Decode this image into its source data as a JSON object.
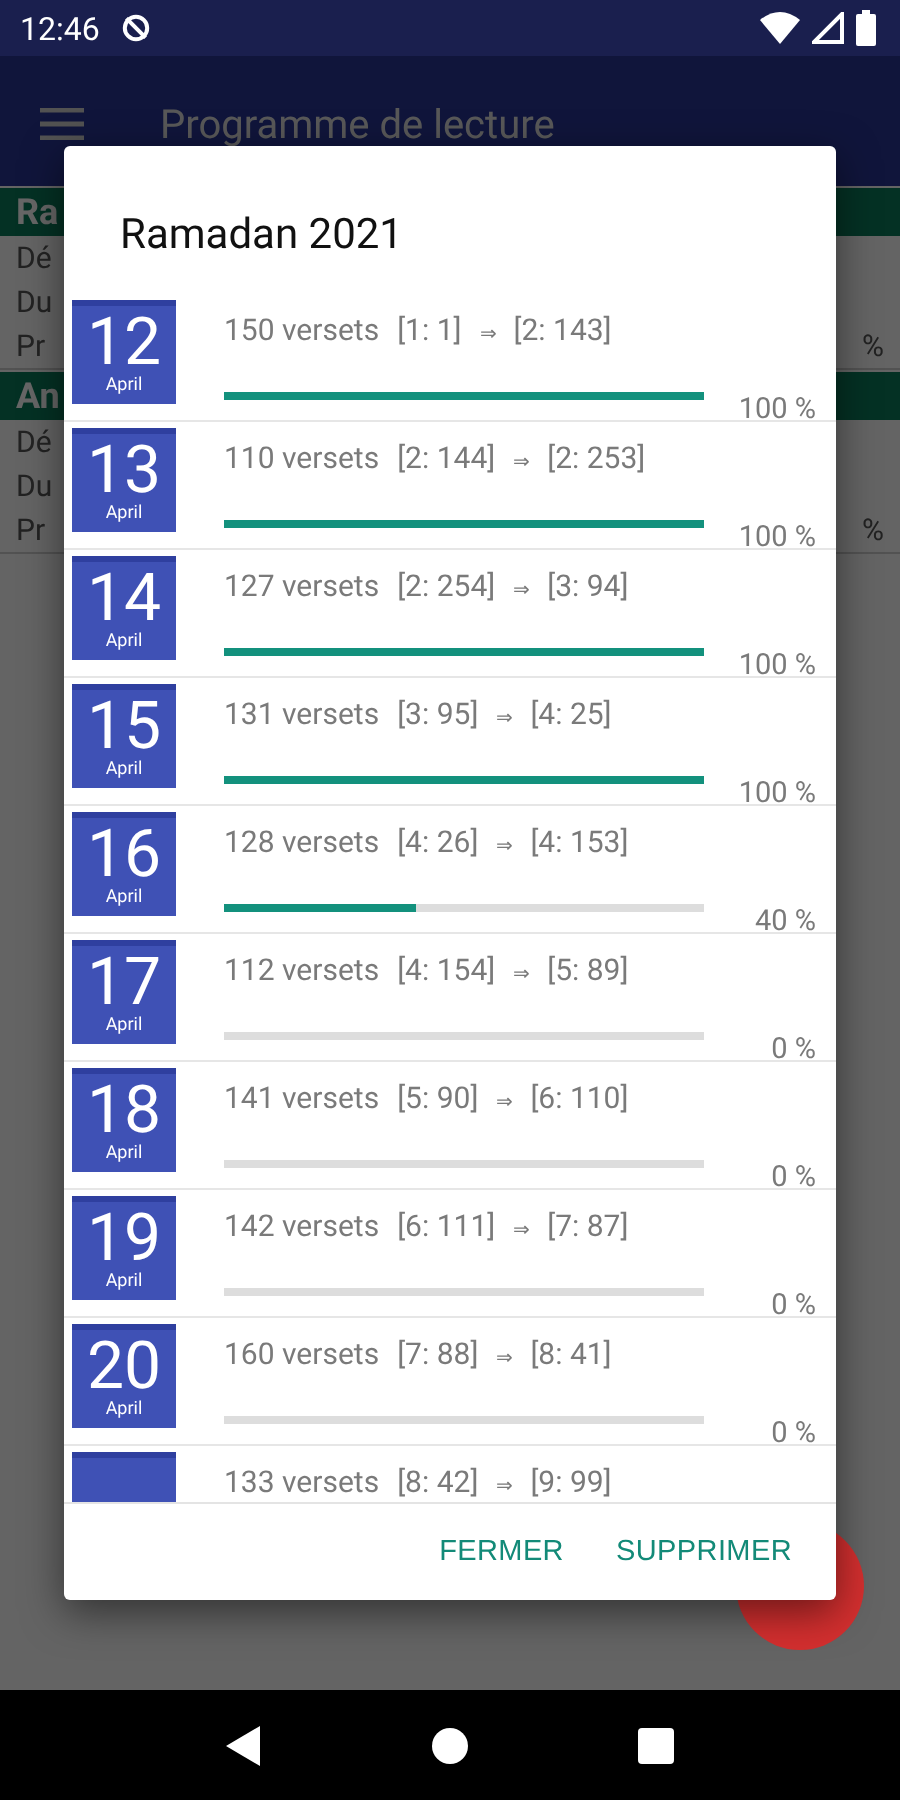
{
  "status_bar": {
    "time": "12:46"
  },
  "app_bar": {
    "title": "Programme de lecture"
  },
  "background_sections": [
    {
      "title": "Ra",
      "rows": [
        {
          "label": "Dé"
        },
        {
          "label": "Du"
        },
        {
          "label": "Pr",
          "value": "%"
        }
      ]
    },
    {
      "title": "An",
      "rows": [
        {
          "label": "Dé"
        },
        {
          "label": "Du"
        },
        {
          "label": "Pr",
          "value": "%"
        }
      ]
    }
  ],
  "dialog": {
    "title": "Ramadan 2021",
    "rows": [
      {
        "day": "12",
        "month": "April",
        "verses": "150 versets",
        "from": "[1: 1]",
        "arrow": "⇒",
        "to": "[2: 143]",
        "level": 1,
        "reading": "100 %"
      },
      {
        "day": "13",
        "month": "April",
        "verses": "110 versets",
        "from": "[2: 144]",
        "arrow": "⇒",
        "to": "[2: 253]",
        "level": 1,
        "reading": "100 %"
      },
      {
        "day": "14",
        "month": "April",
        "verses": "127 versets",
        "from": "[2: 254]",
        "arrow": "⇒",
        "to": "[3: 94]",
        "level": 1,
        "reading": "100 %"
      },
      {
        "day": "15",
        "month": "April",
        "verses": "131 versets",
        "from": "[3: 95]",
        "arrow": "⇒",
        "to": "[4: 25]",
        "level": 1,
        "reading": "100 %"
      },
      {
        "day": "16",
        "month": "April",
        "verses": "128 versets",
        "from": "[4: 26]",
        "arrow": "⇒",
        "to": "[4: 153]",
        "level": 0.4,
        "reading": "40 %"
      },
      {
        "day": "17",
        "month": "April",
        "verses": "112 versets",
        "from": "[4: 154]",
        "arrow": "⇒",
        "to": "[5: 89]",
        "level": 0,
        "reading": "0 %"
      },
      {
        "day": "18",
        "month": "April",
        "verses": "141 versets",
        "from": "[5: 90]",
        "arrow": "⇒",
        "to": "[6: 110]",
        "level": 0,
        "reading": "0 %"
      },
      {
        "day": "19",
        "month": "April",
        "verses": "142 versets",
        "from": "[6: 111]",
        "arrow": "⇒",
        "to": "[7: 87]",
        "level": 0,
        "reading": "0 %"
      },
      {
        "day": "20",
        "month": "April",
        "verses": "160 versets",
        "from": "[7: 88]",
        "arrow": "⇒",
        "to": "[8: 41]",
        "level": 0,
        "reading": "0 %"
      },
      {
        "verses": "133 versets",
        "from": "[8: 42]",
        "arrow": "⇒",
        "to": "[9: 99]"
      }
    ],
    "buttons": [
      "FERMER",
      "SUPPRIMER"
    ]
  }
}
